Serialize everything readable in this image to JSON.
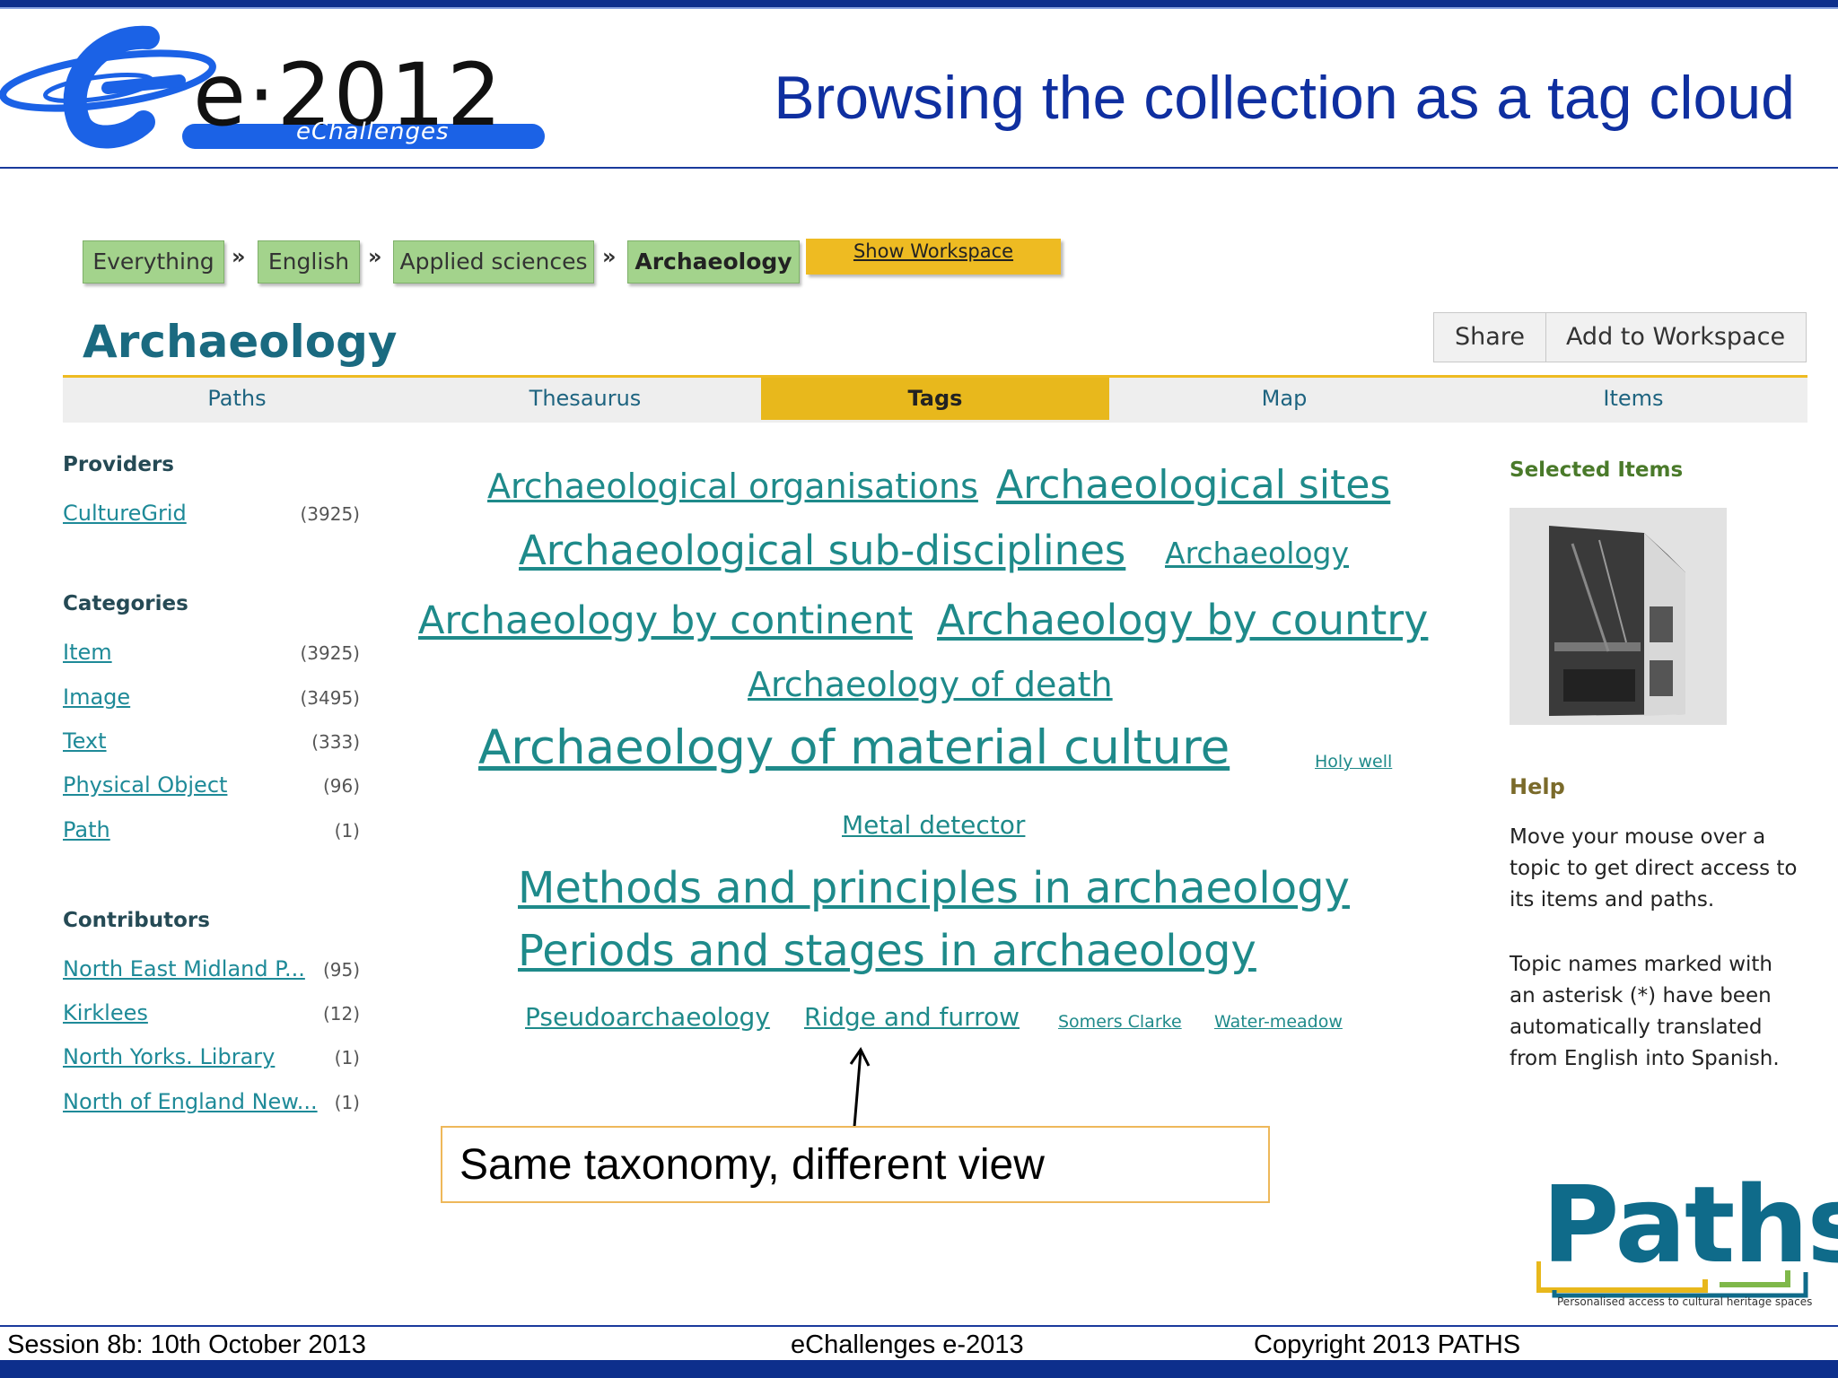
{
  "slide": {
    "title": "Browsing the collection as a tag cloud",
    "logo_text": "e·2012",
    "logo_subtext": "eChallenges",
    "footer_left": "Session 8b:  10th  October 2013",
    "footer_center": "eChallenges e-2013",
    "footer_right": "Copyright 2013 PATHS",
    "colors": {
      "title": "#0f2fa0",
      "bar": "#0d2f8c",
      "crumb": "#a3d38c",
      "tab_active": "#e8b81c",
      "tag": "#1e8a8a"
    }
  },
  "breadcrumb": [
    "Everything",
    "English",
    "Applied sciences",
    "Archaeology"
  ],
  "breadcrumb_separator": "»",
  "show_workspace": "Show Workspace",
  "page": {
    "heading": "Archaeology",
    "share_label": "Share",
    "add_workspace_label": "Add to Workspace"
  },
  "tabs": [
    "Paths",
    "Thesaurus",
    "Tags",
    "Map",
    "Items"
  ],
  "active_tab": "Tags",
  "sidebar": {
    "providers_heading": "Providers",
    "providers": [
      {
        "label": "CultureGrid",
        "count": "(3925)"
      }
    ],
    "categories_heading": "Categories",
    "categories": [
      {
        "label": "Item",
        "count": "(3925)"
      },
      {
        "label": "Image",
        "count": "(3495)"
      },
      {
        "label": "Text",
        "count": "(333)"
      },
      {
        "label": "Physical Object",
        "count": "(96)"
      },
      {
        "label": "Path",
        "count": "(1)"
      }
    ],
    "contributors_heading": "Contributors",
    "contributors": [
      {
        "label": "North East Midland P...",
        "count": "(95)"
      },
      {
        "label": "Kirklees",
        "count": "(12)"
      },
      {
        "label": "North Yorks. Library",
        "count": "(1)"
      },
      {
        "label": "North of England New...",
        "count": "(1)"
      }
    ]
  },
  "tag_cloud": [
    "Archaeological organisations",
    "Archaeological sites",
    "Archaeological sub-disciplines",
    "Archaeology",
    "Archaeology by continent",
    "Archaeology by country",
    "Archaeology of death",
    "Archaeology of material culture",
    "Holy well",
    "Metal detector",
    "Methods and principles in archaeology",
    "Periods and stages in archaeology",
    "Pseudoarchaeology",
    "Ridge and furrow",
    "Somers Clarke",
    "Water-meadow"
  ],
  "right_panel": {
    "selected_heading": "Selected Items",
    "help_heading": "Help",
    "help_lines": [
      "Move your mouse over a",
      "topic to get direct access to",
      "its items and paths.",
      "Topic names marked with",
      "an asterisk (*) have been",
      "automatically translated",
      "from English into Spanish."
    ]
  },
  "callout": "Same taxonomy, different view",
  "paths_logo": {
    "word": "Paths",
    "tagline": "Personalised access to cultural heritage spaces"
  }
}
